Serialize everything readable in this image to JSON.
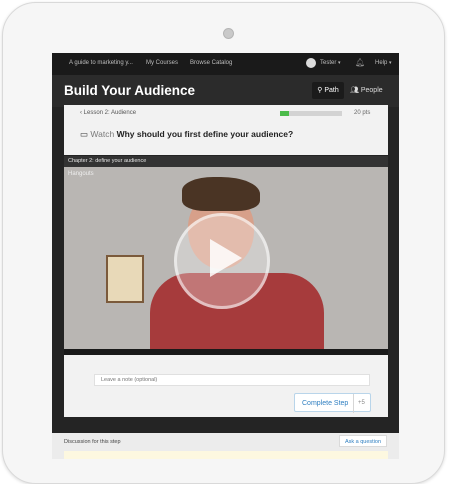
{
  "topnav": {
    "links": [
      "A guide to marketing y...",
      "My Courses",
      "Browse Catalog"
    ],
    "user": "Tester",
    "help": "Help"
  },
  "header": {
    "title": "Build Your Audience",
    "tabs": [
      "Path",
      "People"
    ]
  },
  "lesson": {
    "label": "Lesson 2: Audience",
    "progress_fraction": 0.15,
    "points": "20 pts",
    "watch_label": "Watch",
    "question": "Why should you first define your audience?"
  },
  "chapter": {
    "label": "Chapter 2: define your audience"
  },
  "video": {
    "overlay_text": "Hangouts",
    "play_icon": "play-icon"
  },
  "note": {
    "placeholder": "Leave a note (optional)"
  },
  "complete": {
    "label": "Complete Step",
    "points": "+5"
  },
  "discussion": {
    "label": "Discussion for this step",
    "ask_label": "Ask a question"
  },
  "colors": {
    "accent": "#2f7fc1",
    "progress": "#4cbb4a",
    "dark_bg": "#242424"
  }
}
